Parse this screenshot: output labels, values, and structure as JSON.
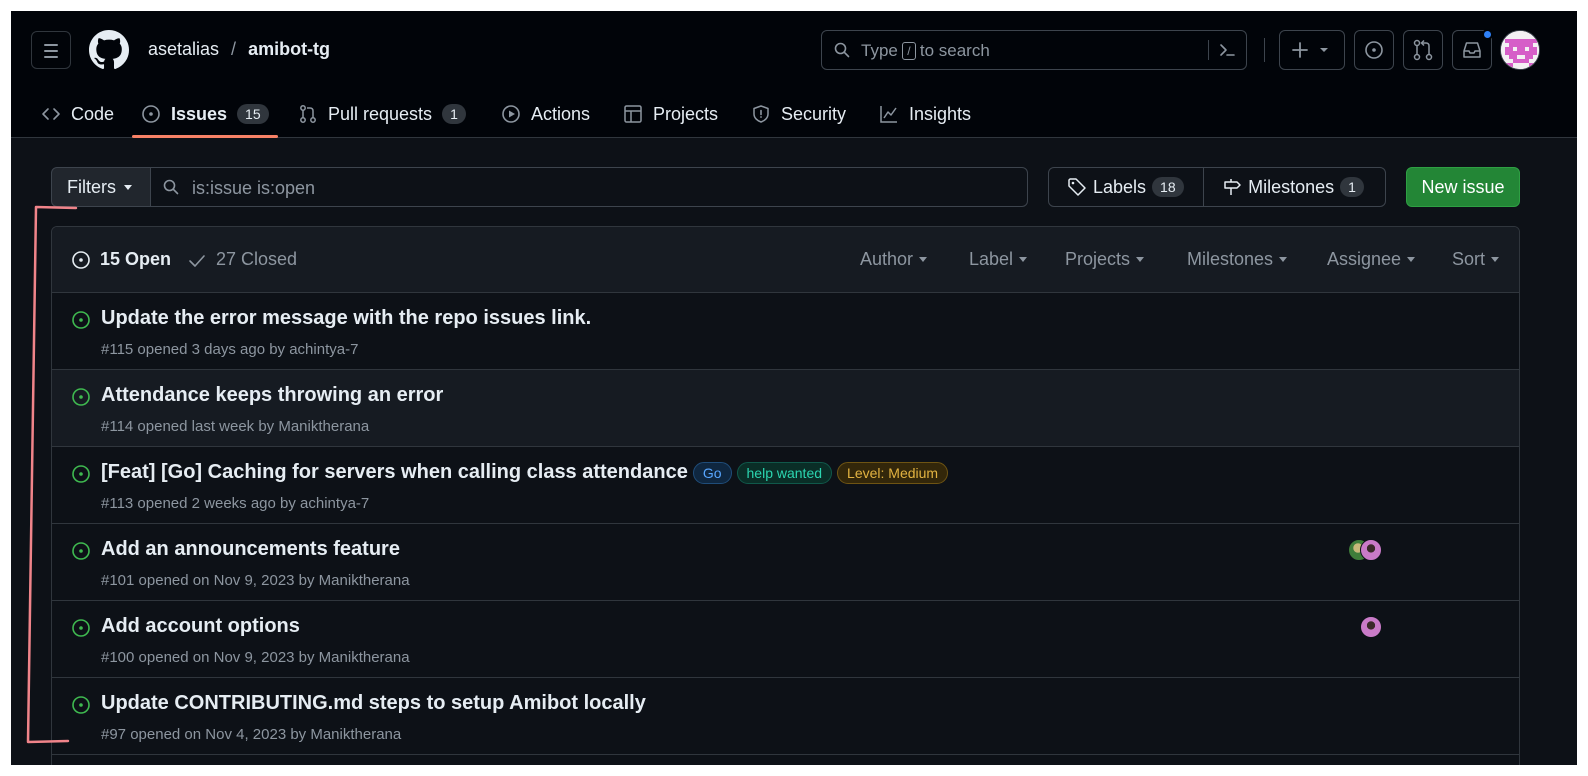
{
  "repo": {
    "owner": "asetalias",
    "separator": "/",
    "name": "amibot-tg"
  },
  "search": {
    "placeholder_before": "Type",
    "key": "/",
    "placeholder_after": "to search"
  },
  "tabs": [
    {
      "label": "Code",
      "icon": "code-icon"
    },
    {
      "label": "Issues",
      "count": "15",
      "icon": "issue-opened-icon",
      "selected": true
    },
    {
      "label": "Pull requests",
      "count": "1",
      "icon": "git-pull-request-icon"
    },
    {
      "label": "Actions",
      "icon": "play-icon"
    },
    {
      "label": "Projects",
      "icon": "table-icon"
    },
    {
      "label": "Security",
      "icon": "shield-icon"
    },
    {
      "label": "Insights",
      "icon": "graph-icon"
    }
  ],
  "filterbar": {
    "filters_label": "Filters",
    "query": "is:issue is:open",
    "labels_label": "Labels",
    "labels_count": "18",
    "milestones_label": "Milestones",
    "milestones_count": "1",
    "new_issue_label": "New issue"
  },
  "list_header": {
    "open_label": "15 Open",
    "closed_label": "27 Closed",
    "filters": [
      "Author",
      "Label",
      "Projects",
      "Milestones",
      "Assignee",
      "Sort"
    ]
  },
  "issues": [
    {
      "title": "Update the error message with the repo issues link.",
      "meta": "#115 opened 3 days ago by achintya-7",
      "labels": [],
      "assignees": 0
    },
    {
      "title": "Attendance keeps throwing an error",
      "meta": "#114 opened last week by Maniktherana",
      "labels": [],
      "assignees": 0
    },
    {
      "title": "[Feat] [Go] Caching for servers when calling class attendance",
      "meta": "#113 opened 2 weeks ago by achintya-7",
      "labels": [
        {
          "name": "Go",
          "color": "#58a6ff"
        },
        {
          "name": "help wanted",
          "color": "#2bd5b0"
        },
        {
          "name": "Level: Medium",
          "color": "#e3b341"
        }
      ],
      "assignees": 0
    },
    {
      "title": "Add an announcements feature",
      "meta": "#101 opened on Nov 9, 2023 by Maniktherana",
      "labels": [],
      "assignees": 2
    },
    {
      "title": "Add account options",
      "meta": "#100 opened on Nov 9, 2023 by Maniktherana",
      "labels": [],
      "assignees": 1
    },
    {
      "title": "Update CONTRIBUTING.md steps to setup Amibot locally",
      "meta": "#97 opened on Nov 4, 2023 by Maniktherana",
      "labels": [],
      "assignees": 0
    }
  ],
  "colors": {
    "background": "#0d1117",
    "header": "#010409",
    "accent_underline": "#f78166",
    "open_green": "#3fb950",
    "primary_button": "#238636",
    "annotation_red": "#f0848a"
  }
}
